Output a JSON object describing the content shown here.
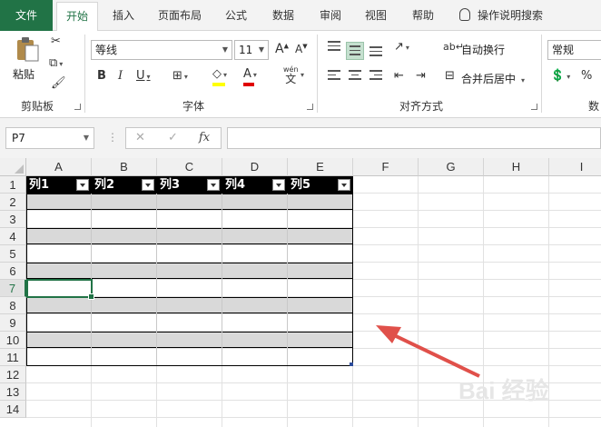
{
  "tabs": {
    "file": "文件",
    "home": "开始",
    "insert": "插入",
    "layout": "页面布局",
    "formulas": "公式",
    "data": "数据",
    "review": "审阅",
    "view": "视图",
    "help": "帮助",
    "tell_me": "操作说明搜索"
  },
  "ribbon": {
    "clipboard": {
      "paste": "粘贴",
      "label": "剪贴板"
    },
    "font": {
      "name": "等线",
      "size": "11",
      "grow": "A",
      "shrink": "A",
      "bold": "B",
      "italic": "I",
      "underline": "U",
      "phonetic": "wén",
      "phonetic_char": "文",
      "label": "字体"
    },
    "alignment": {
      "wrap": "自动换行",
      "merge": "合并后居中",
      "label": "对齐方式"
    },
    "number": {
      "format": "常规",
      "percent": "%",
      "label": "数"
    }
  },
  "formula_bar": {
    "name_box": "P7",
    "fx": "fx",
    "formula": ""
  },
  "grid": {
    "columns": [
      "A",
      "B",
      "C",
      "D",
      "E",
      "F",
      "G",
      "H",
      "I"
    ],
    "rows": [
      "1",
      "2",
      "3",
      "4",
      "5",
      "6",
      "7",
      "8",
      "9",
      "10",
      "11",
      "12",
      "13",
      "14"
    ],
    "selected_row": "7",
    "table_headers": [
      "列1",
      "列2",
      "列3",
      "列4",
      "列5"
    ]
  },
  "colors": {
    "accent": "#217346",
    "band": "#d9d9d9",
    "header_fill": "#000000",
    "arrow": "#e0504a"
  },
  "watermark": "Bai 经验"
}
